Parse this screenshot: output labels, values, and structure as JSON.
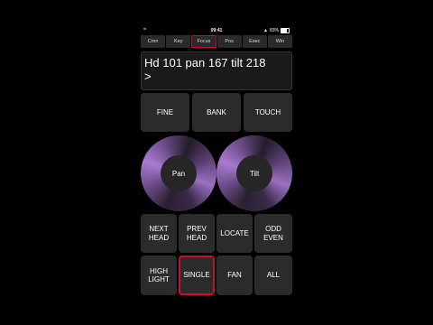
{
  "status": {
    "time": "09:41",
    "battery": "83%",
    "wifi": "wifi-icon",
    "signal": "signal-icon"
  },
  "tabs": [
    {
      "label": "Cmn"
    },
    {
      "label": "Key"
    },
    {
      "label": "Focus"
    },
    {
      "label": "Pos"
    },
    {
      "label": "Exec"
    },
    {
      "label": "Win"
    }
  ],
  "active_tab": "Focus",
  "command_line": {
    "line1": "Hd 101 pan 167 tilt 218",
    "line2": ">"
  },
  "top_buttons": {
    "fine": "FINE",
    "bank": "BANK",
    "touch": "TOUCH"
  },
  "wheels": {
    "pan": "Pan",
    "tilt": "Tilt"
  },
  "grid_buttons": {
    "next_head_1": "NEXT",
    "next_head_2": "HEAD",
    "prev_head_1": "PREV",
    "prev_head_2": "HEAD",
    "locate": "LOCATE",
    "odd_even_1": "ODD",
    "odd_even_2": "EVEN",
    "highlight_1": "HIGH",
    "highlight_2": "LIGHT",
    "single": "SINGLE",
    "fan": "FAN",
    "all": "ALL"
  },
  "colors": {
    "accent": "#c8102e",
    "button_bg": "#2b2b2b",
    "wheel_purple": "#a87ad0"
  }
}
